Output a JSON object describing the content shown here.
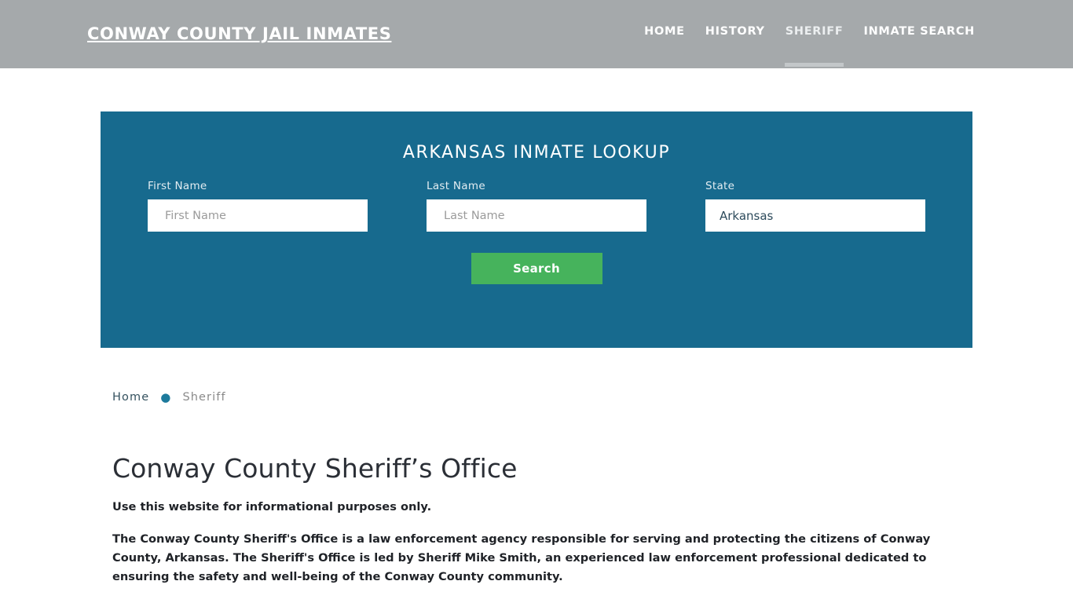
{
  "header": {
    "brand": "CONWAY COUNTY JAIL INMATES",
    "nav": [
      {
        "label": "HOME",
        "active": false
      },
      {
        "label": "HISTORY",
        "active": false
      },
      {
        "label": "SHERIFF",
        "active": true
      },
      {
        "label": "INMATE SEARCH",
        "active": false
      }
    ],
    "background_color": "#a5a9ab"
  },
  "lookup": {
    "title": "ARKANSAS INMATE LOOKUP",
    "panel_color": "#176a8e",
    "first_name": {
      "label": "First Name",
      "placeholder": "First Name",
      "value": ""
    },
    "last_name": {
      "label": "Last Name",
      "placeholder": "Last Name",
      "value": ""
    },
    "state": {
      "label": "State",
      "selected": "Arkansas",
      "options": [
        "Arkansas"
      ]
    },
    "search_button": {
      "label": "Search",
      "color": "#46b35c"
    }
  },
  "breadcrumb": {
    "home": "Home",
    "separator": "●",
    "current": "Sheriff",
    "accent_color": "#1d7a9c"
  },
  "page": {
    "title": "Conway County Sheriff’s Office",
    "paragraphs": [
      "Use this website for informational purposes only.",
      "The Conway County Sheriff's Office is a law enforcement agency responsible for serving and protecting the citizens of Conway County, Arkansas. The Sheriff's Office is led by Sheriff Mike Smith, an experienced law enforcement professional dedicated to ensuring the safety and well-being of the Conway County community."
    ]
  }
}
